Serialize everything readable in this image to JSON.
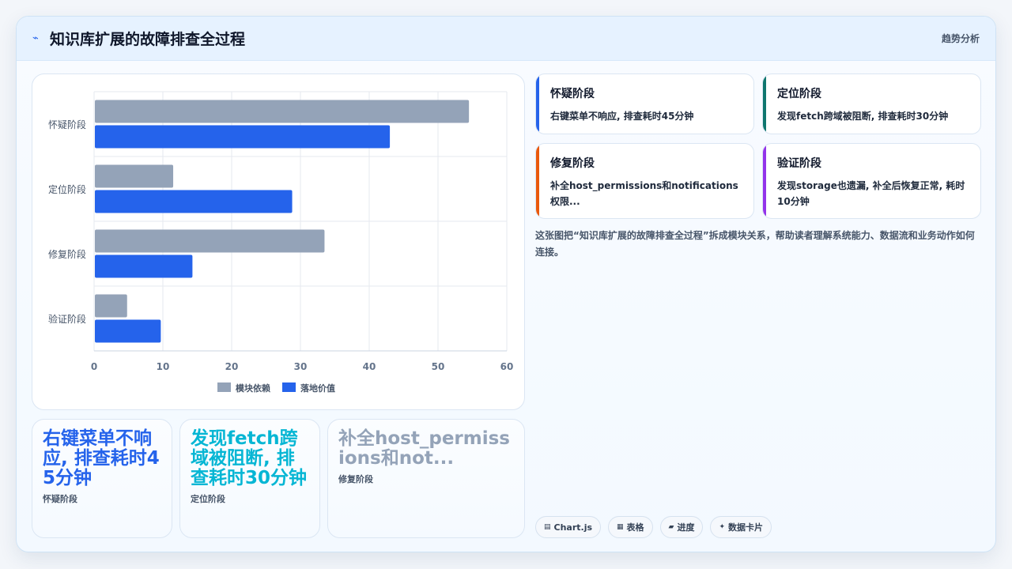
{
  "header": {
    "icon": "trend-icon",
    "title": "知识库扩展的故障排查全过程",
    "right_label": "趋势分析"
  },
  "chart_data": {
    "type": "bar",
    "orientation": "horizontal",
    "categories": [
      "怀疑阶段",
      "定位阶段",
      "修复阶段",
      "验证阶段"
    ],
    "series": [
      {
        "name": "模块依赖",
        "color": "#94a3b8",
        "values": [
          54.5,
          11.5,
          33.5,
          4.8
        ]
      },
      {
        "name": "落地价值",
        "color": "#2563eb",
        "values": [
          43,
          28.8,
          14.3,
          9.7
        ]
      }
    ],
    "xlim": [
      0,
      60
    ],
    "xticks": [
      "0",
      "10",
      "20",
      "30",
      "40",
      "50",
      "60"
    ],
    "grid": true,
    "legend_position": "bottom"
  },
  "cards": [
    {
      "title": "怀疑阶段",
      "desc": "右键菜单不响应, 排查耗时45分钟",
      "color": "#2563eb"
    },
    {
      "title": "定位阶段",
      "desc": "发现fetch跨域被阻断, 排查耗时30分钟",
      "color": "#0f766e"
    },
    {
      "title": "修复阶段",
      "desc": "补全host_permissions和notifications权限...",
      "color": "#ea580c"
    },
    {
      "title": "验证阶段",
      "desc": "发现storage也遗漏, 补全后恢复正常, 耗时10分钟",
      "color": "#9333ea"
    }
  ],
  "description": "这张图把“知识库扩展的故障排查全过程”拆成模块关系，帮助读者理解系统能力、数据流和业务动作如何连接。",
  "stats": [
    {
      "value": "右键菜单不响应, 排查耗时45分钟",
      "label": "怀疑阶段",
      "color": "#2563eb"
    },
    {
      "value": "发现fetch跨域被阻断, 排查耗时30分钟",
      "label": "定位阶段",
      "color": "#06b6d4"
    },
    {
      "value": "补全host_permissions和not...",
      "label": "修复阶段",
      "color": "#94a3b8"
    }
  ],
  "tags": [
    {
      "icon": "chart-icon",
      "label": "Chart.js"
    },
    {
      "icon": "table-icon",
      "label": "表格"
    },
    {
      "icon": "folder-icon",
      "label": "进度"
    },
    {
      "icon": "sparkle-icon",
      "label": "数据卡片"
    }
  ]
}
